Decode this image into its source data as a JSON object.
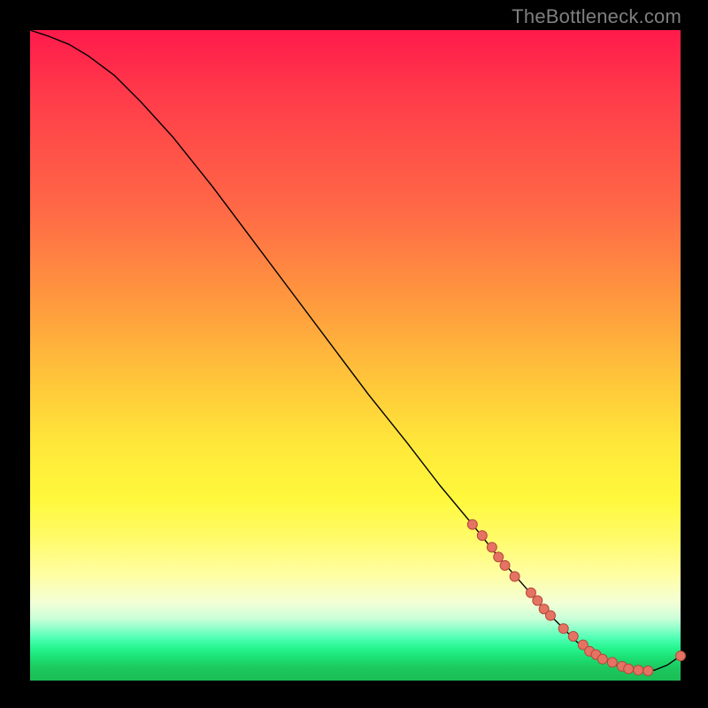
{
  "watermark": "TheBottleneck.com",
  "colors": {
    "background": "#000000",
    "curve": "#000000",
    "dot_fill": "#e57363",
    "dot_stroke": "#b7483b"
  },
  "chart_data": {
    "type": "line",
    "title": "",
    "xlabel": "",
    "ylabel": "",
    "xlim": [
      0,
      100
    ],
    "ylim": [
      0,
      100
    ],
    "series": [
      {
        "name": "curve",
        "x": [
          0,
          3,
          6,
          9,
          13,
          17,
          22,
          28,
          34,
          40,
          46,
          52,
          58,
          63,
          68,
          72,
          76,
          79,
          82,
          84,
          86,
          88,
          90,
          92,
          94,
          96,
          98,
          100
        ],
        "y": [
          100,
          99,
          97.8,
          96,
          93,
          89,
          83.5,
          76,
          68,
          60,
          52,
          44,
          36.5,
          30,
          24,
          19,
          14.5,
          11,
          8,
          6,
          4.5,
          3.3,
          2.4,
          1.8,
          1.5,
          1.6,
          2.4,
          3.8
        ]
      }
    ],
    "dots": {
      "name": "highlighted-range",
      "x": [
        68,
        69.5,
        71,
        72,
        73,
        74.5,
        77,
        78,
        79,
        80,
        82,
        83.5,
        85,
        86,
        87,
        88,
        89.5,
        91,
        92,
        93.5,
        95,
        100
      ],
      "y": [
        24,
        22.3,
        20.5,
        19,
        17.7,
        16,
        13.5,
        12.3,
        11,
        10,
        8,
        6.8,
        5.5,
        4.5,
        4,
        3.3,
        2.8,
        2.2,
        1.8,
        1.6,
        1.5,
        3.8
      ]
    }
  }
}
